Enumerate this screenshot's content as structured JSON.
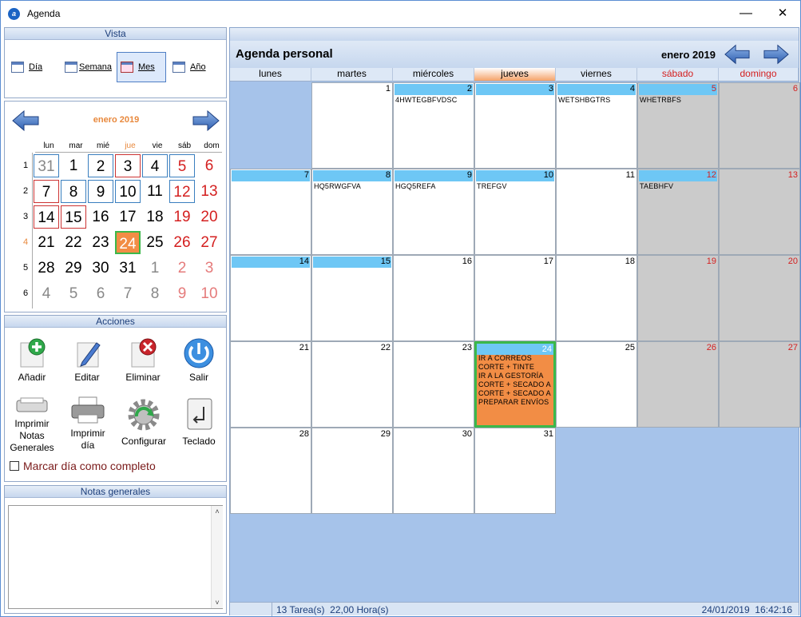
{
  "window": {
    "title": "Agenda",
    "minimize": "—",
    "close": "✕"
  },
  "vista": {
    "header": "Vista",
    "buttons": [
      {
        "label": "Día",
        "icon": "day-calendar-icon"
      },
      {
        "label": "Semana",
        "icon": "week-calendar-icon"
      },
      {
        "label": "Mes",
        "icon": "month-calendar-icon",
        "selected": true
      },
      {
        "label": "Año",
        "icon": "year-calendar-icon"
      }
    ]
  },
  "mini_calendar": {
    "title": "enero 2019",
    "headers": [
      "lun",
      "mar",
      "mié",
      "jue",
      "vie",
      "sáb",
      "dom"
    ],
    "week_numbers": [
      "1",
      "2",
      "3",
      "4",
      "5",
      "6"
    ],
    "current_week": "4",
    "weeks": [
      [
        "31",
        "1",
        "2",
        "3",
        "4",
        "5",
        "6"
      ],
      [
        "7",
        "8",
        "9",
        "10",
        "11",
        "12",
        "13"
      ],
      [
        "14",
        "15",
        "16",
        "17",
        "18",
        "19",
        "20"
      ],
      [
        "21",
        "22",
        "23",
        "24",
        "25",
        "26",
        "27"
      ],
      [
        "28",
        "29",
        "30",
        "31",
        "1",
        "2",
        "3"
      ],
      [
        "4",
        "5",
        "6",
        "7",
        "8",
        "9",
        "10"
      ]
    ],
    "today": "24",
    "colors": {
      "accent": "#e8883c",
      "weekend": "#d42020",
      "other_month": "#888888",
      "today_fill": "#f28d45"
    }
  },
  "acciones": {
    "header": "Acciones",
    "buttons": [
      {
        "label": "Añadir",
        "icon": "add-icon"
      },
      {
        "label": "Editar",
        "icon": "edit-icon"
      },
      {
        "label": "Eliminar",
        "icon": "delete-icon"
      },
      {
        "label": "Salir",
        "icon": "power-icon"
      },
      {
        "label": "Imprimir Notas Generales",
        "icon": "print-notes-icon"
      },
      {
        "label": "Imprimir día",
        "icon": "printer-icon"
      },
      {
        "label": "Configurar",
        "icon": "gear-icon"
      },
      {
        "label": "Teclado",
        "icon": "keyboard-icon"
      }
    ],
    "mark_complete": "Marcar día como completo"
  },
  "notas": {
    "header": "Notas generales",
    "value": ""
  },
  "agenda": {
    "title": "Agenda personal",
    "month": "enero 2019",
    "weekdays": [
      "lunes",
      "martes",
      "miércoles",
      "jueves",
      "viernes",
      "sábado",
      "domingo"
    ],
    "highlight_day": "jueves",
    "cells": [
      {
        "day": "",
        "empty": true
      },
      {
        "day": "1",
        "tasks": []
      },
      {
        "day": "2",
        "bar": true,
        "tasks": [
          "4HWTEGBFVDSC"
        ]
      },
      {
        "day": "3",
        "bar": true,
        "tasks": []
      },
      {
        "day": "4",
        "bar": true,
        "tasks": [
          "WETSHBGTRS"
        ]
      },
      {
        "day": "5",
        "bar": true,
        "weekend": true,
        "tasks": [
          "WHETRBFS"
        ]
      },
      {
        "day": "6",
        "weekend": true,
        "tasks": []
      },
      {
        "day": "7",
        "bar": true,
        "tasks": []
      },
      {
        "day": "8",
        "bar": true,
        "tasks": [
          "HQ5RWGFVA"
        ]
      },
      {
        "day": "9",
        "bar": true,
        "tasks": [
          "HGQ5REFA"
        ]
      },
      {
        "day": "10",
        "bar": true,
        "tasks": [
          "TREFGV"
        ]
      },
      {
        "day": "11",
        "tasks": []
      },
      {
        "day": "12",
        "bar": true,
        "weekend": true,
        "tasks": [
          "TAEBHFV"
        ]
      },
      {
        "day": "13",
        "weekend": true,
        "tasks": []
      },
      {
        "day": "14",
        "bar": true,
        "tasks": []
      },
      {
        "day": "15",
        "bar": true,
        "tasks": []
      },
      {
        "day": "16",
        "tasks": []
      },
      {
        "day": "17",
        "tasks": []
      },
      {
        "day": "18",
        "tasks": []
      },
      {
        "day": "19",
        "weekend": true,
        "tasks": []
      },
      {
        "day": "20",
        "weekend": true,
        "tasks": []
      },
      {
        "day": "21",
        "tasks": []
      },
      {
        "day": "22",
        "tasks": []
      },
      {
        "day": "23",
        "tasks": []
      },
      {
        "day": "24",
        "bar": true,
        "today": true,
        "tasks": [
          "IR A CORREOS",
          "CORTE + TINTE",
          "IR A LA GESTORÍA",
          "CORTE + SECADO A",
          "CORTE + SECADO A",
          "PREPARAR ENVÍOS"
        ]
      },
      {
        "day": "25",
        "tasks": []
      },
      {
        "day": "26",
        "weekend": true,
        "tasks": []
      },
      {
        "day": "27",
        "weekend": true,
        "tasks": []
      },
      {
        "day": "28",
        "tasks": []
      },
      {
        "day": "29",
        "tasks": []
      },
      {
        "day": "30",
        "tasks": []
      },
      {
        "day": "31",
        "tasks": []
      }
    ]
  },
  "status": {
    "left": "13 Tarea(s)  22,00 Hora(s)",
    "right": "24/01/2019  16:42:16"
  }
}
